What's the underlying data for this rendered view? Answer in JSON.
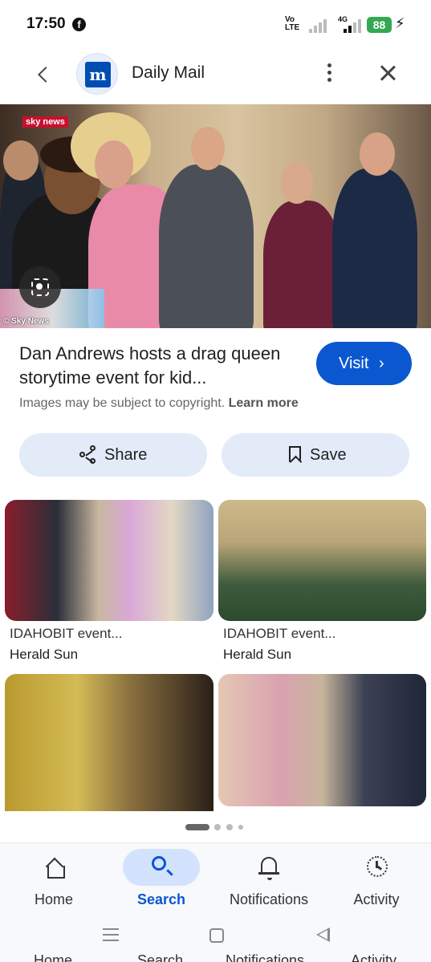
{
  "status_bar": {
    "time": "17:50",
    "facebook_icon": "facebook-icon",
    "volte_top": "Vo",
    "volte_bottom": "LTE",
    "network": "4G",
    "battery": "88",
    "charging_icon": "bolt-icon"
  },
  "header": {
    "site_name": "Daily Mail",
    "logo_glyph": "m",
    "back_icon": "chevron-left-icon",
    "more_icon": "more-vert-icon",
    "close_icon": "close-icon"
  },
  "main_image": {
    "logo_text": "sky news",
    "credit": "© Sky News"
  },
  "result": {
    "title": "Dan Andrews hosts a drag queen storytime event for kid...",
    "visit_label": "Visit",
    "copyright_text": "Images may be subject to copyright.",
    "learn_more": "Learn more"
  },
  "actions": {
    "share_label": "Share",
    "save_label": "Save"
  },
  "related": [
    {
      "title": "IDAHOBIT event...",
      "source": "Herald Sun"
    },
    {
      "title": "IDAHOBIT event...",
      "source": "Herald Sun"
    }
  ],
  "bottom_nav": [
    {
      "label": "Home",
      "icon": "home-icon",
      "active": false
    },
    {
      "label": "Search",
      "icon": "search-icon",
      "active": true
    },
    {
      "label": "Notifications",
      "icon": "bell-icon",
      "active": false
    },
    {
      "label": "Activity",
      "icon": "activity-icon",
      "active": false
    }
  ],
  "colors": {
    "accent": "#0b57d0",
    "pill_bg": "#e3ebf9",
    "active_nav_bg": "#d3e3fd"
  }
}
